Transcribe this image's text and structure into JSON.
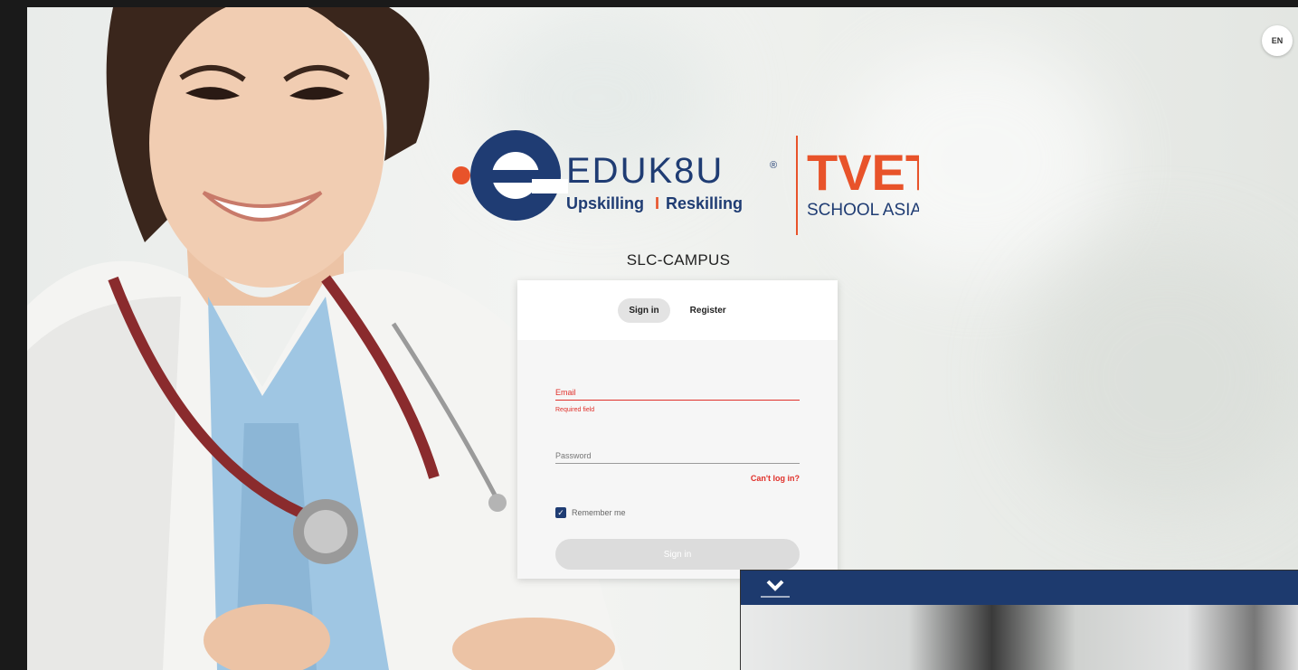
{
  "language": {
    "code": "EN"
  },
  "brand": {
    "name": "EDUK8U",
    "tagline_left": "Upskilling",
    "tagline_sep": "I",
    "tagline_right": "Reskilling",
    "partner_top": "TVET",
    "partner_bottom": "SCHOOL ASIA"
  },
  "campus": {
    "name": "SLC-CAMPUS"
  },
  "auth": {
    "tabs": [
      {
        "label": "Sign in",
        "active": true
      },
      {
        "label": "Register",
        "active": false
      }
    ],
    "email": {
      "label": "Email",
      "error": "Required field"
    },
    "password": {
      "label": "Password"
    },
    "forgot_label": "Can't log in?",
    "remember": {
      "label": "Remember me",
      "checked": true
    },
    "submit_label": "Sign in"
  },
  "colors": {
    "brand_navy": "#1f3c73",
    "brand_orange": "#e8532a",
    "error_red": "#e0302a",
    "overlay_bar": "#1d3a6e"
  },
  "icons": {
    "logo_mark": "eduk8u-e-logo",
    "checkbox": "check-icon",
    "overlay_logo": "chevron-down-icon"
  }
}
